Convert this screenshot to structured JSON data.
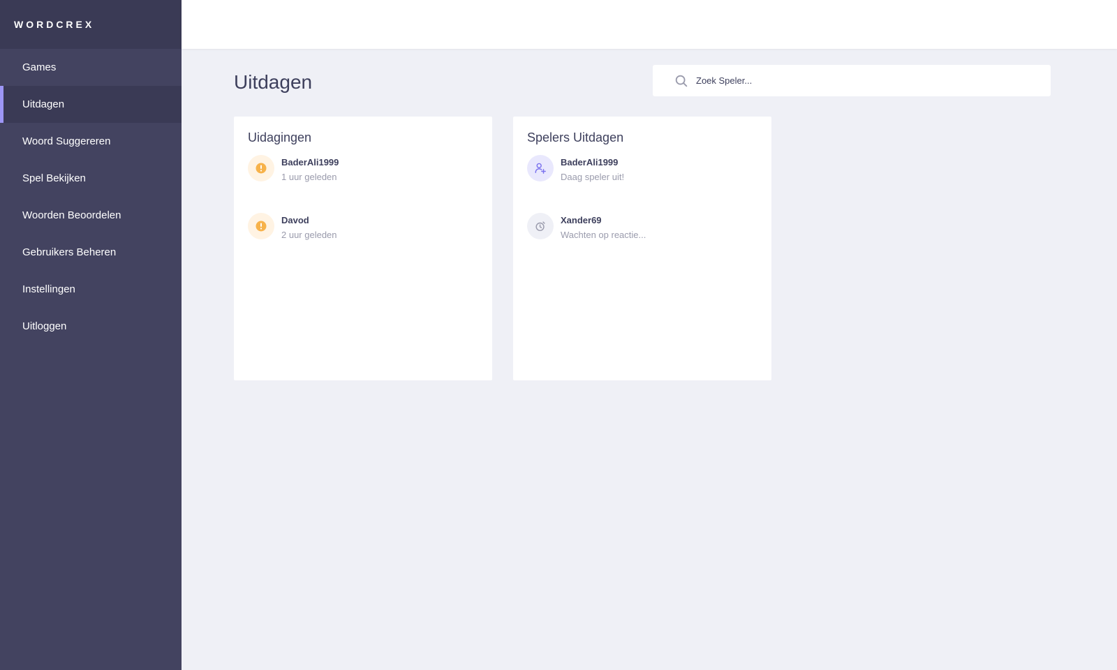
{
  "app": {
    "brand": "WORDCREX"
  },
  "sidebar": {
    "items": [
      {
        "label": "Games"
      },
      {
        "label": "Uitdagen"
      },
      {
        "label": "Woord Suggereren"
      },
      {
        "label": "Spel Bekijken"
      },
      {
        "label": "Woorden Beoordelen"
      },
      {
        "label": "Gebruikers Beheren"
      },
      {
        "label": "Instellingen"
      },
      {
        "label": "Uitloggen"
      }
    ],
    "active": "Uitdagen"
  },
  "main": {
    "title": "Uitdagen",
    "search": {
      "placeholder": "Zoek Speler..."
    }
  },
  "challenges": {
    "title": "Uidagingen",
    "items": [
      {
        "name": "BaderAli1999",
        "sub": "1 uur geleden",
        "icon": "alert-icon"
      },
      {
        "name": "Davod",
        "sub": "2 uur geleden",
        "icon": "alert-icon"
      }
    ]
  },
  "players": {
    "title": "Spelers Uitdagen",
    "items": [
      {
        "name": "BaderAli1999",
        "sub": "Daag speler uit!",
        "icon": "add-user-icon"
      },
      {
        "name": "Xander69",
        "sub": "Wachten op reactie...",
        "icon": "timer-icon"
      }
    ]
  },
  "colors": {
    "sidebar": "#434360",
    "sidebar_active": "#3a3a55",
    "accent": "#9d96f5",
    "warning": "#f7b24a",
    "background": "#eff0f6"
  }
}
